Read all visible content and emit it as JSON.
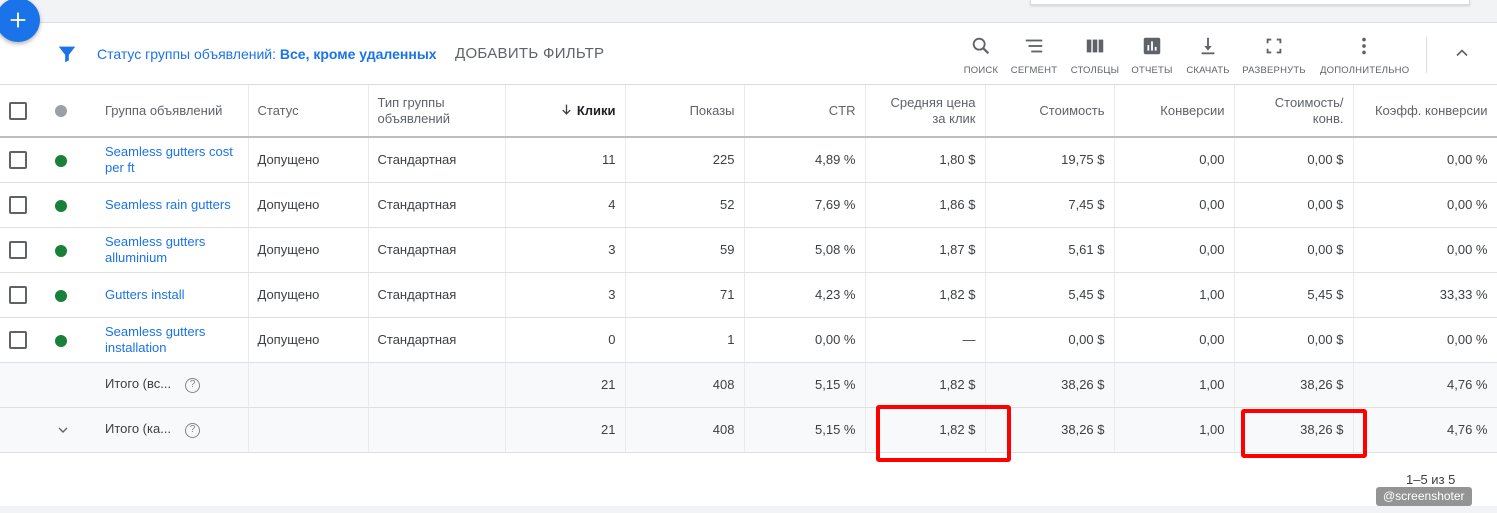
{
  "fab": {
    "icon": "plus-icon"
  },
  "filter": {
    "label": "Статус группы объявлений:",
    "value": "Все, кроме удаленных",
    "add_filter": "ДОБАВИТЬ ФИЛЬТР"
  },
  "tools": [
    {
      "label": "ПОИСК",
      "icon": "search-icon"
    },
    {
      "label": "СЕГМЕНТ",
      "icon": "segment-icon"
    },
    {
      "label": "СТОЛБЦЫ",
      "icon": "columns-icon"
    },
    {
      "label": "ОТЧЕТЫ",
      "icon": "reports-icon"
    },
    {
      "label": "СКАЧАТЬ",
      "icon": "download-icon"
    },
    {
      "label": "РАЗВЕРНУТЬ",
      "icon": "expand-icon"
    },
    {
      "label": "ДОПОЛНИТЕЛЬНО",
      "icon": "more-vert-icon"
    }
  ],
  "columns": {
    "group": "Группа объявлений",
    "status": "Статус",
    "type": "Тип группы объявлений",
    "clicks": "Клики",
    "impressions": "Показы",
    "ctr": "CTR",
    "avg_cpc": "Средняя цена за клик",
    "cost": "Стоимость",
    "conversions": "Конверсии",
    "cost_conv": "Стоимость/ конв.",
    "conv_rate": "Коэфф. конверсии"
  },
  "rows": [
    {
      "name": "Seamless gutters cost per ft",
      "status": "Допущено",
      "type": "Стандартная",
      "clicks": "11",
      "impressions": "225",
      "ctr": "4,89 %",
      "avg_cpc": "1,80 $",
      "cost": "19,75 $",
      "conversions": "0,00",
      "cost_conv": "0,00 $",
      "conv_rate": "0,00 %"
    },
    {
      "name": "Seamless rain gutters",
      "status": "Допущено",
      "type": "Стандартная",
      "clicks": "4",
      "impressions": "52",
      "ctr": "7,69 %",
      "avg_cpc": "1,86 $",
      "cost": "7,45 $",
      "conversions": "0,00",
      "cost_conv": "0,00 $",
      "conv_rate": "0,00 %"
    },
    {
      "name": "Seamless gutters alluminium",
      "status": "Допущено",
      "type": "Стандартная",
      "clicks": "3",
      "impressions": "59",
      "ctr": "5,08 %",
      "avg_cpc": "1,87 $",
      "cost": "5,61 $",
      "conversions": "0,00",
      "cost_conv": "0,00 $",
      "conv_rate": "0,00 %"
    },
    {
      "name": "Gutters install",
      "status": "Допущено",
      "type": "Стандартная",
      "clicks": "3",
      "impressions": "71",
      "ctr": "4,23 %",
      "avg_cpc": "1,82 $",
      "cost": "5,45 $",
      "conversions": "1,00",
      "cost_conv": "5,45 $",
      "conv_rate": "33,33 %"
    },
    {
      "name": "Seamless gutters installation",
      "status": "Допущено",
      "type": "Стандартная",
      "clicks": "0",
      "impressions": "1",
      "ctr": "0,00 %",
      "avg_cpc": "—",
      "cost": "0,00 $",
      "conversions": "0,00",
      "cost_conv": "0,00 $",
      "conv_rate": "0,00 %"
    }
  ],
  "totals": [
    {
      "label": "Итого (вс...",
      "clicks": "21",
      "impressions": "408",
      "ctr": "5,15 %",
      "avg_cpc": "1,82 $",
      "cost": "38,26 $",
      "conversions": "1,00",
      "cost_conv": "38,26 $",
      "conv_rate": "4,76 %"
    },
    {
      "label": "Итого (ка...",
      "clicks": "21",
      "impressions": "408",
      "ctr": "5,15 %",
      "avg_cpc": "1,82 $",
      "cost": "38,26 $",
      "conversions": "1,00",
      "cost_conv": "38,26 $",
      "conv_rate": "4,76 %"
    }
  ],
  "pager": "1–5 из 5",
  "watermark": "@screenshoter",
  "colors": {
    "accent": "#1a73e8",
    "status_ok": "#188038",
    "highlight": "#ff0000"
  }
}
